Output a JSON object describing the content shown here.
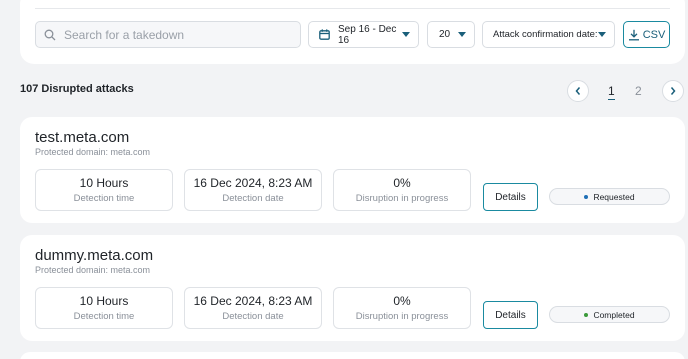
{
  "filters": {
    "search_placeholder": "Search for a takedown",
    "date_range": "Sep 16 - Dec 16",
    "page_size": "20",
    "sort_by": "Attack confirmation date:",
    "export_label": "CSV"
  },
  "summary": {
    "text": "107 Disrupted attacks"
  },
  "pagination": {
    "pages": [
      "1",
      "2"
    ],
    "current": "1"
  },
  "attacks": [
    {
      "domain": "test.meta.com",
      "protected": "Protected domain: meta.com",
      "detection_time": "10 Hours",
      "detection_time_label": "Detection time",
      "detection_date": "16 Dec 2024, 8:23 AM",
      "detection_date_label": "Detection date",
      "disruption": "0%",
      "disruption_label": "Disruption in progress",
      "details_label": "Details",
      "status": "Requested",
      "status_color": "#1f6fb5"
    },
    {
      "domain": "dummy.meta.com",
      "protected": "Protected domain: meta.com",
      "detection_time": "10 Hours",
      "detection_time_label": "Detection time",
      "detection_date": "16 Dec 2024, 8:23 AM",
      "detection_date_label": "Detection date",
      "disruption": "0%",
      "disruption_label": "Disruption in progress",
      "details_label": "Details",
      "status": "Completed",
      "status_color": "#3a9a3a"
    }
  ]
}
